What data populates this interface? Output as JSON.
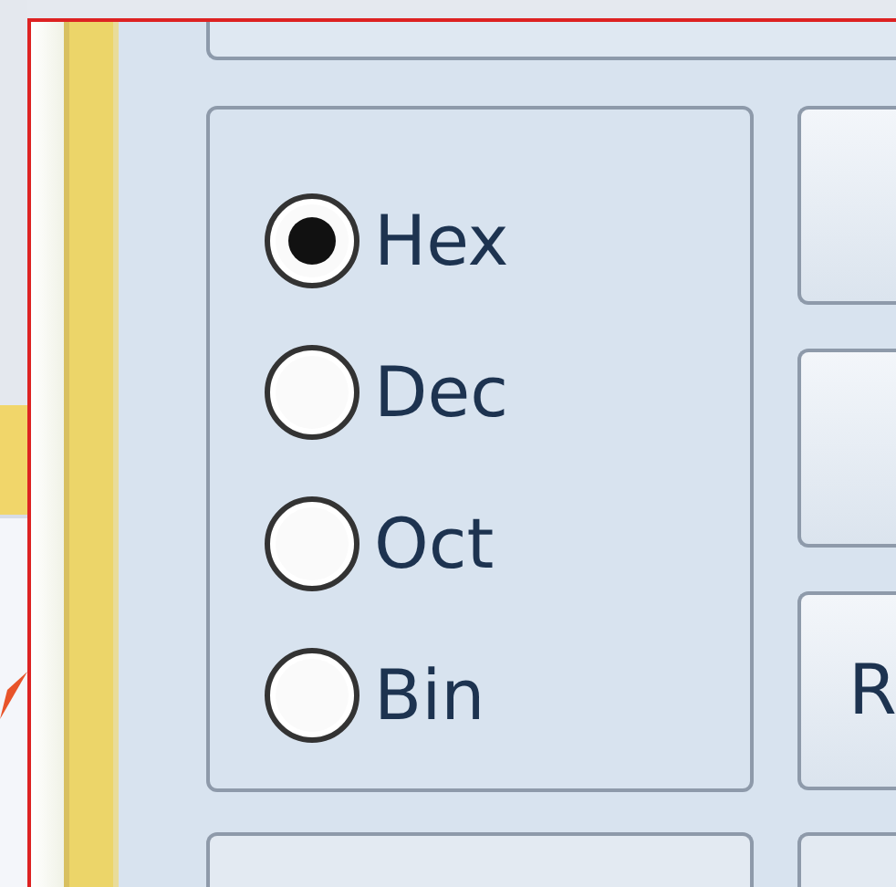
{
  "radix_options": [
    {
      "label": "Hex",
      "selected": true
    },
    {
      "label": "Dec",
      "selected": false
    },
    {
      "label": "Oct",
      "selected": false
    },
    {
      "label": "Bin",
      "selected": false
    }
  ],
  "side_button_label": "R"
}
